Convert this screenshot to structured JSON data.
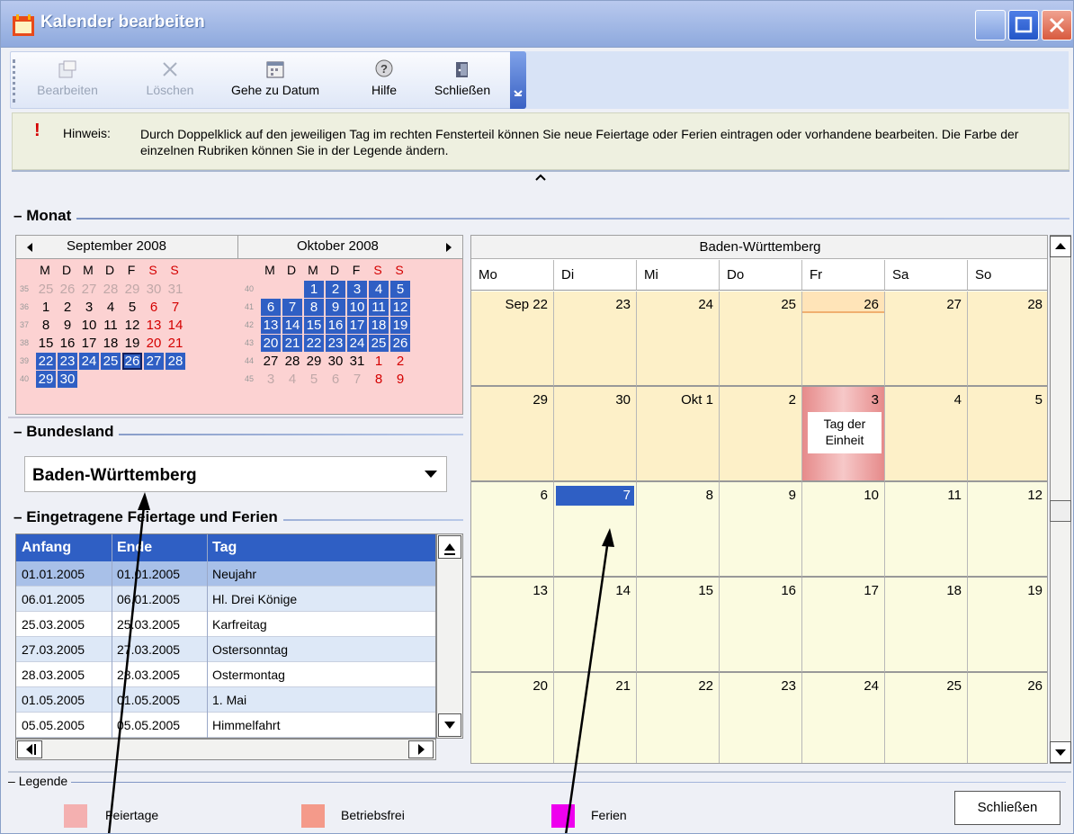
{
  "window": {
    "title": "Kalender bearbeiten"
  },
  "toolbar": {
    "items": [
      {
        "label": "Bearbeiten",
        "icon": "edit-icon",
        "enabled": false
      },
      {
        "label": "Löschen",
        "icon": "delete-icon",
        "enabled": false
      },
      {
        "label": "Gehe zu Datum",
        "icon": "calendar-goto-icon",
        "enabled": true
      },
      {
        "label": "Hilfe",
        "icon": "help-icon",
        "enabled": true
      },
      {
        "label": "Schließen",
        "icon": "close-door-icon",
        "enabled": true
      }
    ]
  },
  "hint": {
    "label": "Hinweis:",
    "text": "Durch Doppelklick auf den jeweiligen Tag im rechten Fensterteil können Sie neue Feiertage oder Ferien eintragen oder vorhandene bearbeiten. Die Farbe der einzelnen Rubriken können Sie in der Legende ändern."
  },
  "sections": {
    "monat": "Monat",
    "bundesland": "Bundesland",
    "eingetragen": "Eingetragene Feiertage und Ferien",
    "legende": "Legende"
  },
  "mini_calendar": {
    "months": [
      "September 2008",
      "Oktober 2008"
    ],
    "weekdays": [
      "M",
      "D",
      "M",
      "D",
      "F",
      "S",
      "S"
    ],
    "september": [
      {
        "wk": "35",
        "days": [
          "25",
          "26",
          "27",
          "28",
          "29",
          "30",
          "31"
        ]
      },
      {
        "wk": "36",
        "days": [
          "1",
          "2",
          "3",
          "4",
          "5",
          "6",
          "7"
        ]
      },
      {
        "wk": "37",
        "days": [
          "8",
          "9",
          "10",
          "11",
          "12",
          "13",
          "14"
        ]
      },
      {
        "wk": "38",
        "days": [
          "15",
          "16",
          "17",
          "18",
          "19",
          "20",
          "21"
        ]
      },
      {
        "wk": "39",
        "days": [
          "22",
          "23",
          "24",
          "25",
          "26",
          "27",
          "28"
        ]
      },
      {
        "wk": "40",
        "days": [
          "29",
          "30",
          "",
          "",
          "",
          "",
          ""
        ]
      }
    ],
    "oktober": [
      {
        "wk": "40",
        "days": [
          "",
          "",
          "1",
          "2",
          "3",
          "4",
          "5"
        ]
      },
      {
        "wk": "41",
        "days": [
          "6",
          "7",
          "8",
          "9",
          "10",
          "11",
          "12"
        ]
      },
      {
        "wk": "42",
        "days": [
          "13",
          "14",
          "15",
          "16",
          "17",
          "18",
          "19"
        ]
      },
      {
        "wk": "43",
        "days": [
          "20",
          "21",
          "22",
          "23",
          "24",
          "25",
          "26"
        ]
      },
      {
        "wk": "44",
        "days": [
          "27",
          "28",
          "29",
          "30",
          "31",
          "1",
          "2"
        ]
      },
      {
        "wk": "45",
        "days": [
          "3",
          "4",
          "5",
          "6",
          "7",
          "8",
          "9"
        ]
      }
    ]
  },
  "state": {
    "selected": "Baden-Württemberg"
  },
  "holidays": {
    "columns": [
      "Anfang",
      "Ende",
      "Tag"
    ],
    "rows": [
      [
        "01.01.2005",
        "01.01.2005",
        "Neujahr"
      ],
      [
        "06.01.2005",
        "06.01.2005",
        "Hl. Drei Könige"
      ],
      [
        "25.03.2005",
        "25.03.2005",
        "Karfreitag"
      ],
      [
        "27.03.2005",
        "27.03.2005",
        "Ostersonntag"
      ],
      [
        "28.03.2005",
        "28.03.2005",
        "Ostermontag"
      ],
      [
        "01.05.2005",
        "01.05.2005",
        "1. Mai"
      ],
      [
        "05.05.2005",
        "05.05.2005",
        "Himmelfahrt"
      ]
    ]
  },
  "calendar": {
    "region": "Baden-Württemberg",
    "weekdays": [
      "Mo",
      "Di",
      "Mi",
      "Do",
      "Fr",
      "Sa",
      "So"
    ],
    "weeks": [
      [
        "Sep 22",
        "23",
        "24",
        "25",
        "26",
        "27",
        "28"
      ],
      [
        "29",
        "30",
        "Okt 1",
        "2",
        "3",
        "4",
        "5"
      ],
      [
        "6",
        "7",
        "8",
        "9",
        "10",
        "11",
        "12"
      ],
      [
        "13",
        "14",
        "15",
        "16",
        "17",
        "18",
        "19"
      ],
      [
        "20",
        "21",
        "22",
        "23",
        "24",
        "25",
        "26"
      ]
    ],
    "holiday_caption": "Tag der Einheit"
  },
  "legend": {
    "items": [
      {
        "label": "Feiertage",
        "color": "#f4b0b0"
      },
      {
        "label": "Betriebsfrei",
        "color": "#f49a8a"
      },
      {
        "label": "Ferien",
        "color": "#ee00ee"
      }
    ],
    "close_label": "Schließen"
  }
}
